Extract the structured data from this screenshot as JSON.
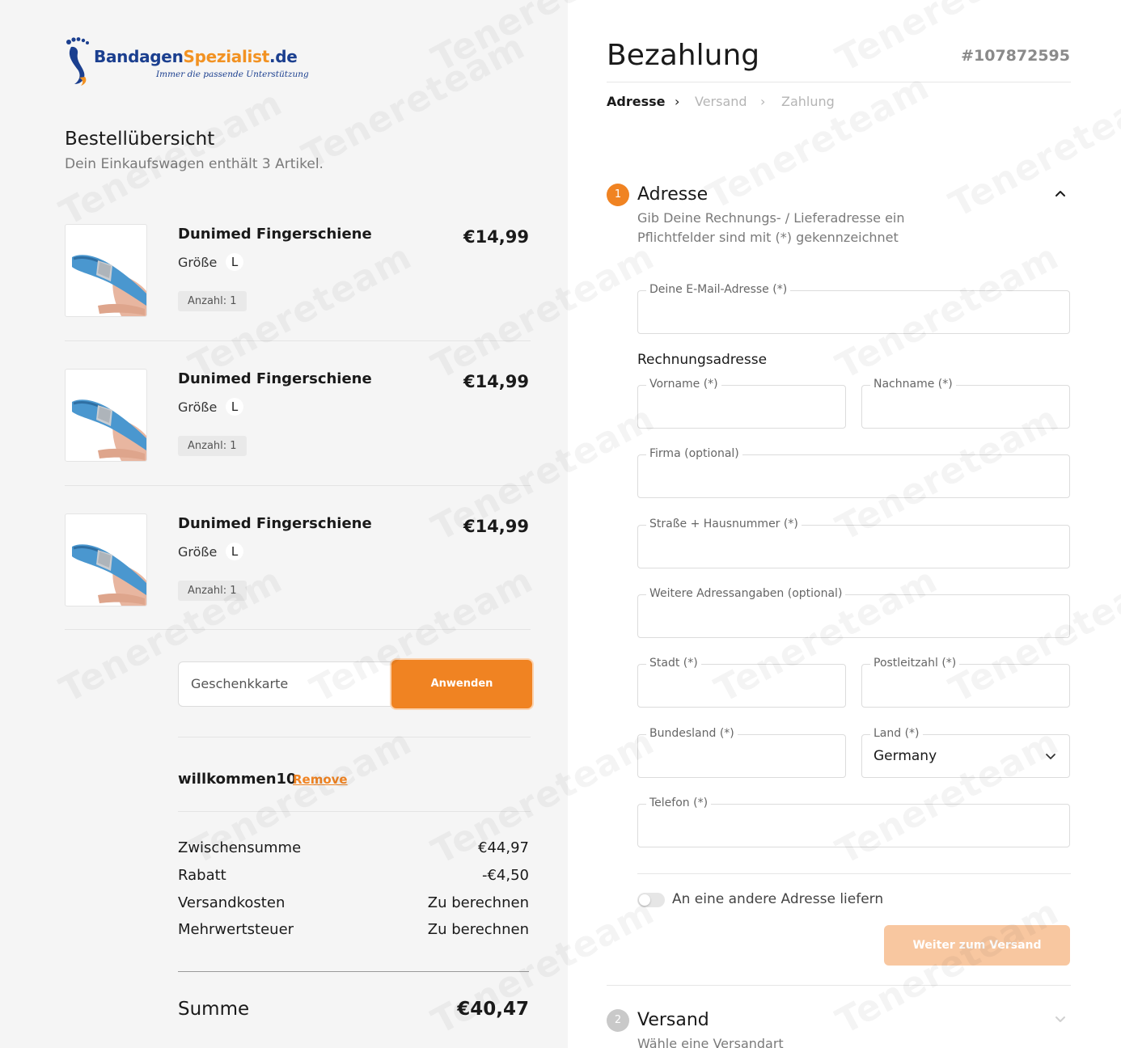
{
  "brand": {
    "name_part1": "Bandagen",
    "name_part2": "Spezialist",
    "name_part3": ".de",
    "tagline": "Immer die passende Unterstützung",
    "colors": {
      "blue": "#1b3f8f",
      "orange": "#f29222"
    }
  },
  "overview": {
    "title": "Bestellübersicht",
    "subtitle": "Dein Einkaufswagen enthält 3 Artikel.",
    "items": [
      {
        "name": "Dunimed Fingerschiene",
        "price": "€14,99",
        "size_label": "Größe",
        "size": "L",
        "qty": "Anzahl: 1",
        "image_icon": "finger-splint-icon"
      },
      {
        "name": "Dunimed Fingerschiene",
        "price": "€14,99",
        "size_label": "Größe",
        "size": "L",
        "qty": "Anzahl: 1",
        "image_icon": "finger-splint-icon"
      },
      {
        "name": "Dunimed Fingerschiene",
        "price": "€14,99",
        "size_label": "Größe",
        "size": "L",
        "qty": "Anzahl: 1",
        "image_icon": "finger-splint-icon"
      }
    ],
    "giftcard": {
      "placeholder": "Geschenkkarte",
      "button": "Anwenden"
    },
    "coupon": {
      "code": "willkommen10",
      "remove": "Remove"
    },
    "totals": [
      {
        "label": "Zwischensumme",
        "value": "€44,97"
      },
      {
        "label": "Rabatt",
        "value": "-€4,50"
      },
      {
        "label": "Versandkosten",
        "value": "Zu berechnen"
      },
      {
        "label": "Mehrwertsteuer",
        "value": "Zu berechnen"
      }
    ],
    "sum": {
      "label": "Summe",
      "value": "€40,47"
    }
  },
  "checkout": {
    "title": "Bezahlung",
    "order_number": "#107872595",
    "breadcrumbs": [
      {
        "label": "Adresse",
        "active": true
      },
      {
        "label": "Versand",
        "active": false
      },
      {
        "label": "Zahlung",
        "active": false
      }
    ],
    "breadcrumb_separator": "›",
    "step1": {
      "number": "1",
      "title": "Adresse",
      "desc1": "Gib Deine Rechnungs- / Lieferadresse ein",
      "desc2": "Pflichtfelder sind mit (*) gekennzeichnet"
    },
    "fields": {
      "email": "Deine E-Mail-Adresse (*)",
      "billing_heading": "Rechnungsadresse",
      "firstname": "Vorname (*)",
      "lastname": "Nachname (*)",
      "company": "Firma (optional)",
      "street": "Straße + Hausnummer (*)",
      "address2": "Weitere Adressangaben (optional)",
      "city": "Stadt (*)",
      "zip": "Postleitzahl (*)",
      "state": "Bundesland (*)",
      "country_label": "Land (*)",
      "country_value": "Germany",
      "phone": "Telefon (*)"
    },
    "ship_toggle": {
      "label": "An eine andere Adresse liefern",
      "on": false
    },
    "next_button": "Weiter zum Versand",
    "step2": {
      "number": "2",
      "title": "Versand",
      "desc": "Wähle eine Versandart"
    },
    "accent_color": "#f08322"
  },
  "watermark": "Tenereteam"
}
